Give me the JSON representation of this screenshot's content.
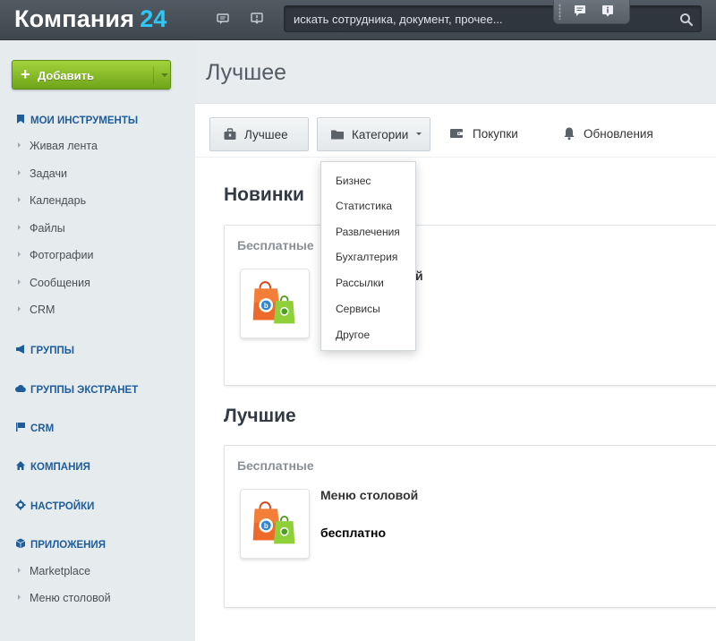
{
  "header": {
    "logo_name": "Компания",
    "logo_number": "24",
    "search_placeholder": "искать сотрудника, документ, прочее..."
  },
  "sidebar": {
    "add_button": "Добавить",
    "sections": {
      "tools": "МОИ ИНСТРУМЕНТЫ",
      "groups": "ГРУППЫ",
      "extranet": "ГРУППЫ ЭКСТРАНЕТ",
      "crm": "CRM",
      "company": "КОМПАНИЯ",
      "settings": "НАСТРОЙКИ",
      "apps": "ПРИЛОЖЕНИЯ"
    },
    "tool_items": [
      "Живая лента",
      "Задачи",
      "Календарь",
      "Файлы",
      "Фотографии",
      "Сообщения",
      "CRM"
    ],
    "app_items": [
      "Marketplace",
      "Меню столовой"
    ]
  },
  "main": {
    "title": "Лучшее",
    "tabs": [
      "Лучшее",
      "Категории",
      "Покупки",
      "Обновления"
    ],
    "new_section": {
      "title": "Новинки",
      "subtitle": "Бесплатные",
      "partial_name": "й"
    },
    "best_section": {
      "title": "Лучшие",
      "subtitle": "Бесплатные",
      "app_name": "Меню столовой",
      "app_price": "бесплатно"
    }
  },
  "categories_menu": [
    "Бизнес",
    "Статистика",
    "Развлечения",
    "Бухгалтерия",
    "Рассылки",
    "Сервисы",
    "Другое"
  ],
  "colors": {
    "header_bg": "#4a5259",
    "accent_blue": "#2fc6f6",
    "sidebar_link": "#1f5c9a",
    "add_button": "#8ec22b"
  }
}
